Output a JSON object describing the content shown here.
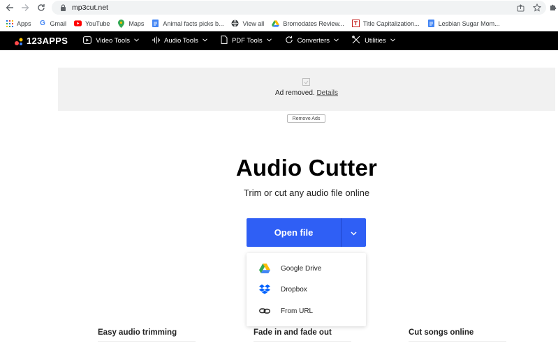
{
  "browser": {
    "url": "mp3cut.net",
    "bookmarks": [
      {
        "label": "Apps",
        "icon": "apps-grid-icon"
      },
      {
        "label": "Gmail",
        "icon": "google-icon"
      },
      {
        "label": "YouTube",
        "icon": "youtube-icon"
      },
      {
        "label": "Maps",
        "icon": "maps-icon"
      },
      {
        "label": "Animal facts picks b...",
        "icon": "docs-icon"
      },
      {
        "label": "View all",
        "icon": "globe-icon"
      },
      {
        "label": "Bromodates Review...",
        "icon": "drive-icon"
      },
      {
        "label": "Title Capitalization...",
        "icon": "title-icon"
      },
      {
        "label": "Lesbian Sugar Mom...",
        "icon": "docs-icon"
      }
    ]
  },
  "site": {
    "logo": "123APPS",
    "menu": [
      {
        "label": "Video Tools",
        "icon": "video-icon"
      },
      {
        "label": "Audio Tools",
        "icon": "waveform-icon"
      },
      {
        "label": "PDF Tools",
        "icon": "document-icon"
      },
      {
        "label": "Converters",
        "icon": "refresh-icon"
      },
      {
        "label": "Utilities",
        "icon": "tools-icon"
      }
    ]
  },
  "ad": {
    "text": "Ad removed.",
    "details": "Details",
    "remove_ads": "Remove Ads"
  },
  "hero": {
    "title": "Audio Cutter",
    "subtitle": "Trim or cut any audio file online",
    "open_file": "Open file"
  },
  "dropdown": {
    "items": [
      {
        "label": "Google Drive",
        "icon": "google-drive-icon"
      },
      {
        "label": "Dropbox",
        "icon": "dropbox-icon"
      },
      {
        "label": "From URL",
        "icon": "link-icon"
      }
    ]
  },
  "features": [
    "Easy audio trimming",
    "Fade in and fade out",
    "Cut songs online"
  ],
  "colors": {
    "accent": "#2f5ff5",
    "nav_bg": "#000000"
  }
}
